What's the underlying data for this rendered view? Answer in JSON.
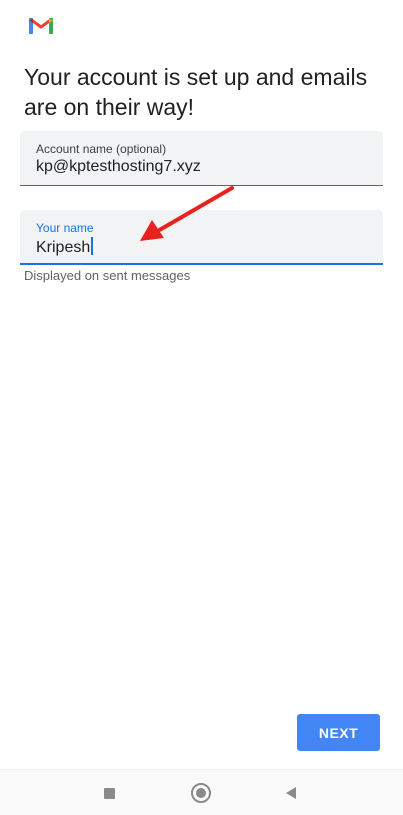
{
  "app": {
    "logo_icon": "gmail-logo-icon"
  },
  "headline": "Your account is set up and emails are on their way!",
  "account_field": {
    "label": "Account name (optional)",
    "value": "kp@kptesthosting7.xyz"
  },
  "name_field": {
    "label": "Your name",
    "value": "Kripesh",
    "helper": "Displayed on sent messages",
    "accent_color": "#1a73e8"
  },
  "annotation": {
    "icon": "red-arrow-icon",
    "color": "#e8231f"
  },
  "next_button": {
    "label": "NEXT",
    "color": "#4285f4"
  },
  "nav_bar": {
    "recents_icon": "square-recents-icon",
    "home_icon": "circle-home-icon",
    "back_icon": "triangle-back-icon"
  }
}
